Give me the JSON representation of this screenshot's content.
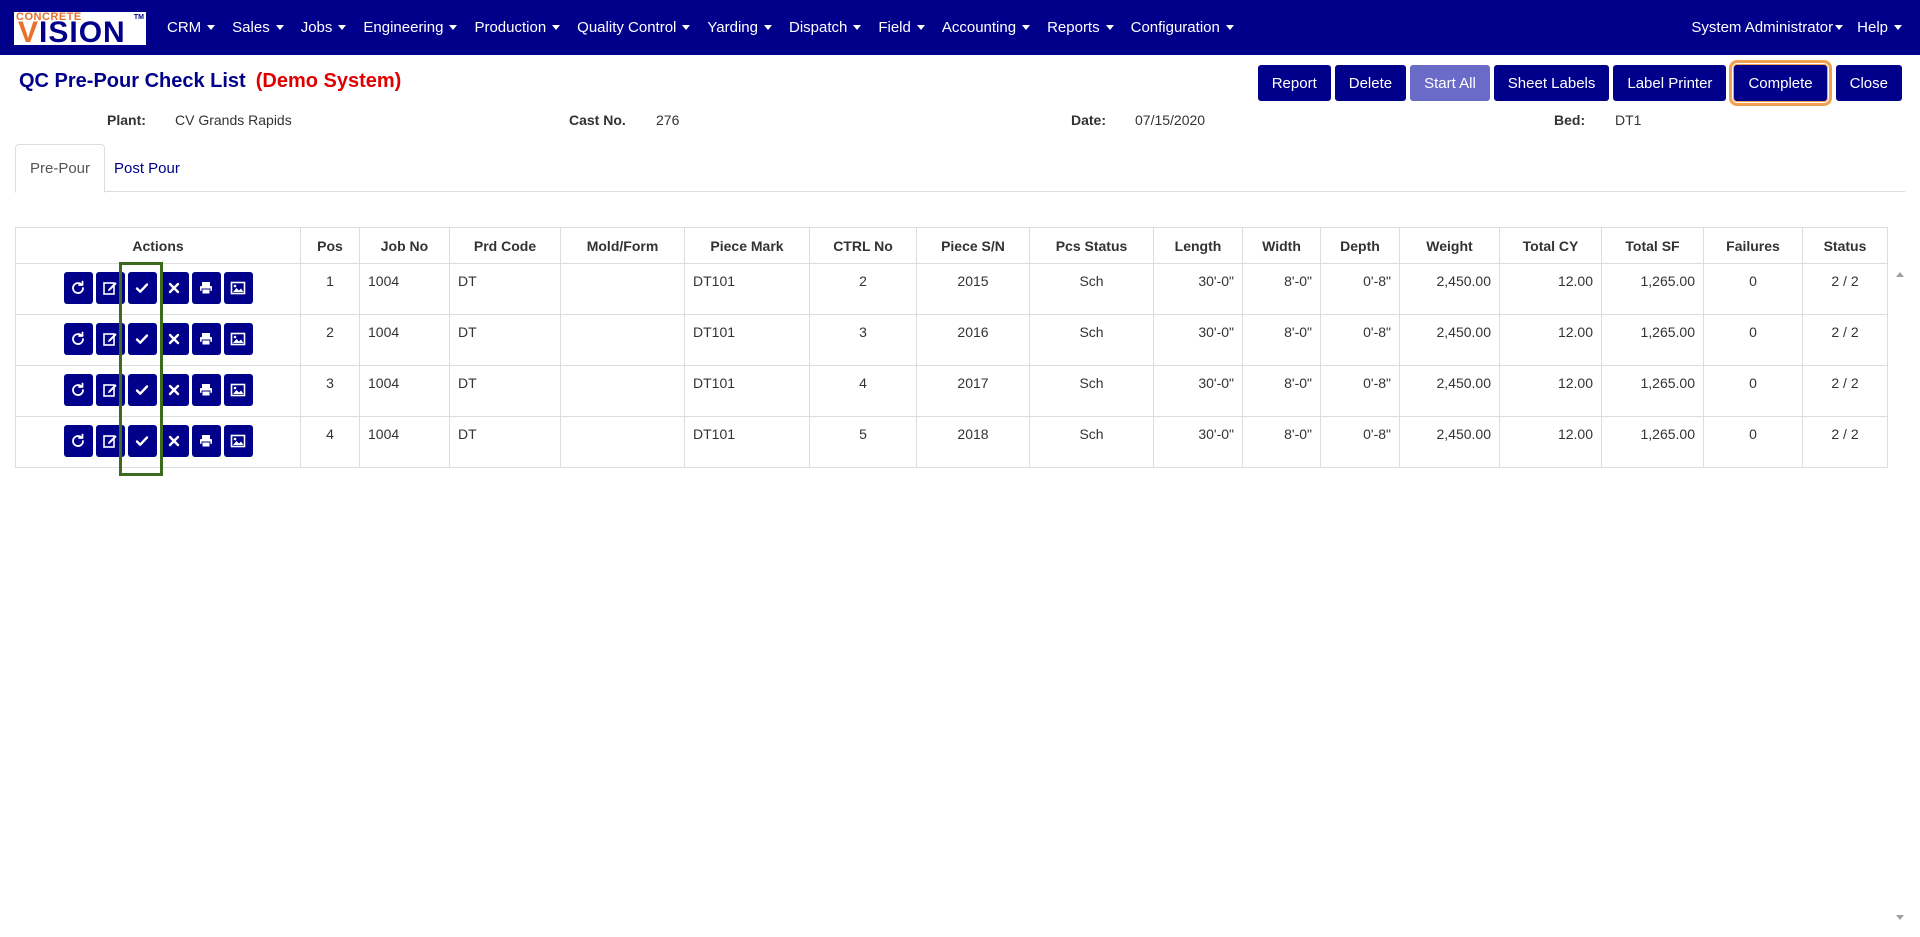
{
  "nav": {
    "logo_small": "CONCRETE",
    "logo_v": "V",
    "logo_rest": "ISION",
    "logo_tm": "TM",
    "menu": [
      "CRM",
      "Sales",
      "Jobs",
      "Engineering",
      "Production",
      "Quality Control",
      "Yarding",
      "Dispatch",
      "Field",
      "Accounting",
      "Reports",
      "Configuration"
    ],
    "user": "System Administrator",
    "help": "Help"
  },
  "page": {
    "title": "QC Pre-Pour Check List",
    "demo": "(Demo System)"
  },
  "toolbar": {
    "report": "Report",
    "delete": "Delete",
    "start_all": "Start All",
    "sheet_labels": "Sheet Labels",
    "label_printer": "Label Printer",
    "complete": "Complete",
    "close": "Close"
  },
  "info": {
    "plant_label": "Plant:",
    "plant_value": "CV Grands Rapids",
    "cast_label": "Cast No.",
    "cast_value": "276",
    "date_label": "Date:",
    "date_value": "07/15/2020",
    "bed_label": "Bed:",
    "bed_value": "DT1"
  },
  "tabs": {
    "pre_pour": "Pre-Pour",
    "post_pour": "Post Pour"
  },
  "table": {
    "headers": [
      "Actions",
      "Pos",
      "Job No",
      "Prd Code",
      "Mold/Form",
      "Piece Mark",
      "CTRL No",
      "Piece S/N",
      "Pcs Status",
      "Length",
      "Width",
      "Depth",
      "Weight",
      "Total CY",
      "Total SF",
      "Failures",
      "Status"
    ],
    "rows": [
      {
        "pos": "1",
        "job": "1004",
        "prd": "DT",
        "mold": "",
        "mark": "DT101",
        "ctrl": "2",
        "sn": "2015",
        "pstatus": "Sch",
        "length": "30'-0\"",
        "width": "8'-0\"",
        "depth": "0'-8\"",
        "weight": "2,450.00",
        "cy": "12.00",
        "sf": "1,265.00",
        "failures": "0",
        "status": "2 / 2"
      },
      {
        "pos": "2",
        "job": "1004",
        "prd": "DT",
        "mold": "",
        "mark": "DT101",
        "ctrl": "3",
        "sn": "2016",
        "pstatus": "Sch",
        "length": "30'-0\"",
        "width": "8'-0\"",
        "depth": "0'-8\"",
        "weight": "2,450.00",
        "cy": "12.00",
        "sf": "1,265.00",
        "failures": "0",
        "status": "2 / 2"
      },
      {
        "pos": "3",
        "job": "1004",
        "prd": "DT",
        "mold": "",
        "mark": "DT101",
        "ctrl": "4",
        "sn": "2017",
        "pstatus": "Sch",
        "length": "30'-0\"",
        "width": "8'-0\"",
        "depth": "0'-8\"",
        "weight": "2,450.00",
        "cy": "12.00",
        "sf": "1,265.00",
        "failures": "0",
        "status": "2 / 2"
      },
      {
        "pos": "4",
        "job": "1004",
        "prd": "DT",
        "mold": "",
        "mark": "DT101",
        "ctrl": "5",
        "sn": "2018",
        "pstatus": "Sch",
        "length": "30'-0\"",
        "width": "8'-0\"",
        "depth": "0'-8\"",
        "weight": "2,450.00",
        "cy": "12.00",
        "sf": "1,265.00",
        "failures": "0",
        "status": "2 / 2"
      }
    ],
    "row_actions": [
      "refresh-icon",
      "edit-icon",
      "check-icon",
      "close-icon",
      "print-icon",
      "image-icon"
    ]
  },
  "colors": {
    "brand": "#00008b",
    "demo": "#e00000",
    "accent_orange": "#e8702a",
    "highlight_green": "#3d6b1e",
    "highlight_orange": "#f0a050"
  }
}
